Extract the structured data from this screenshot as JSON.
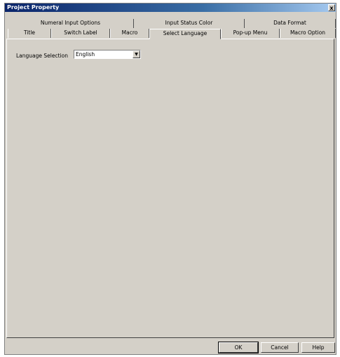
{
  "window": {
    "title": "Project Property",
    "close_label": "x"
  },
  "tabs_back": [
    {
      "label": "Numeral Input Options"
    },
    {
      "label": "Input Status Color"
    },
    {
      "label": "Data Format"
    }
  ],
  "tabs_front": [
    {
      "label": "Title"
    },
    {
      "label": "Switch Label"
    },
    {
      "label": "Macro"
    },
    {
      "label": "Select Language"
    },
    {
      "label": "Pop-up Menu"
    },
    {
      "label": "Macro Option"
    }
  ],
  "active_tab": "Select Language",
  "language": {
    "label": "Language Selection",
    "value": "English",
    "arrow_icon": "chevron-down-icon"
  },
  "buttons": {
    "ok": "OK",
    "cancel": "Cancel",
    "help": "Help"
  }
}
